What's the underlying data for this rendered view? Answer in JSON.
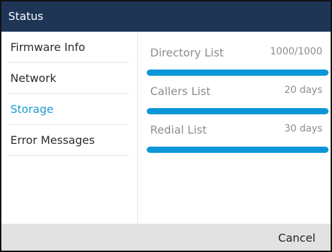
{
  "header": {
    "title": "Status"
  },
  "sidebar": {
    "items": [
      {
        "label": "Firmware Info",
        "active": false
      },
      {
        "label": "Network",
        "active": false
      },
      {
        "label": "Storage",
        "active": true
      },
      {
        "label": "Error Messages",
        "active": false
      }
    ]
  },
  "storage": {
    "rows": [
      {
        "label": "Directory List",
        "value": "1000/1000",
        "fill_percent": 100
      },
      {
        "label": "Callers List",
        "value": "20 days",
        "fill_percent": 100
      },
      {
        "label": "Redial List",
        "value": "30 days",
        "fill_percent": 100
      }
    ]
  },
  "footer": {
    "cancel_label": "Cancel"
  },
  "colors": {
    "title_bar": "#1e3556",
    "accent": "#1a9ad6",
    "progress": "#0b96d7",
    "footer": "#e2e2e2"
  }
}
